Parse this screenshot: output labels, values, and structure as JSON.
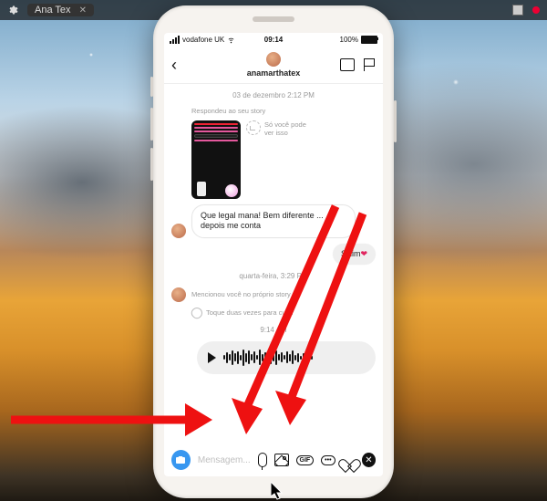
{
  "menubar": {
    "tab_title": "Ana Tex",
    "tab_close": "✕"
  },
  "status": {
    "carrier": "vodafone UK",
    "wifi_glyph": "✦",
    "time": "09:14",
    "battery_pct": "100%"
  },
  "header": {
    "username": "anamarthatex"
  },
  "thread": {
    "date1": "03 de dezembro 2:12 PM",
    "reply_label": "Respondeu ao seu story",
    "story_visibility_1": "Só você pode",
    "story_visibility_2": "ver isso",
    "incoming_msg": "Que legal mana! Bem diferente ... depois me conta",
    "outgoing_msg": "Siiiim",
    "heart": "❤",
    "date2": "quarta-feira, 3:29 PM",
    "mention_label": "Mencionou você no próprio story",
    "tap_label": "Toque duas vezes para curtir",
    "time_audio": "9:14 AM"
  },
  "composer": {
    "placeholder": "Mensagem...",
    "gif_label": "GIF",
    "dots": "•••"
  }
}
